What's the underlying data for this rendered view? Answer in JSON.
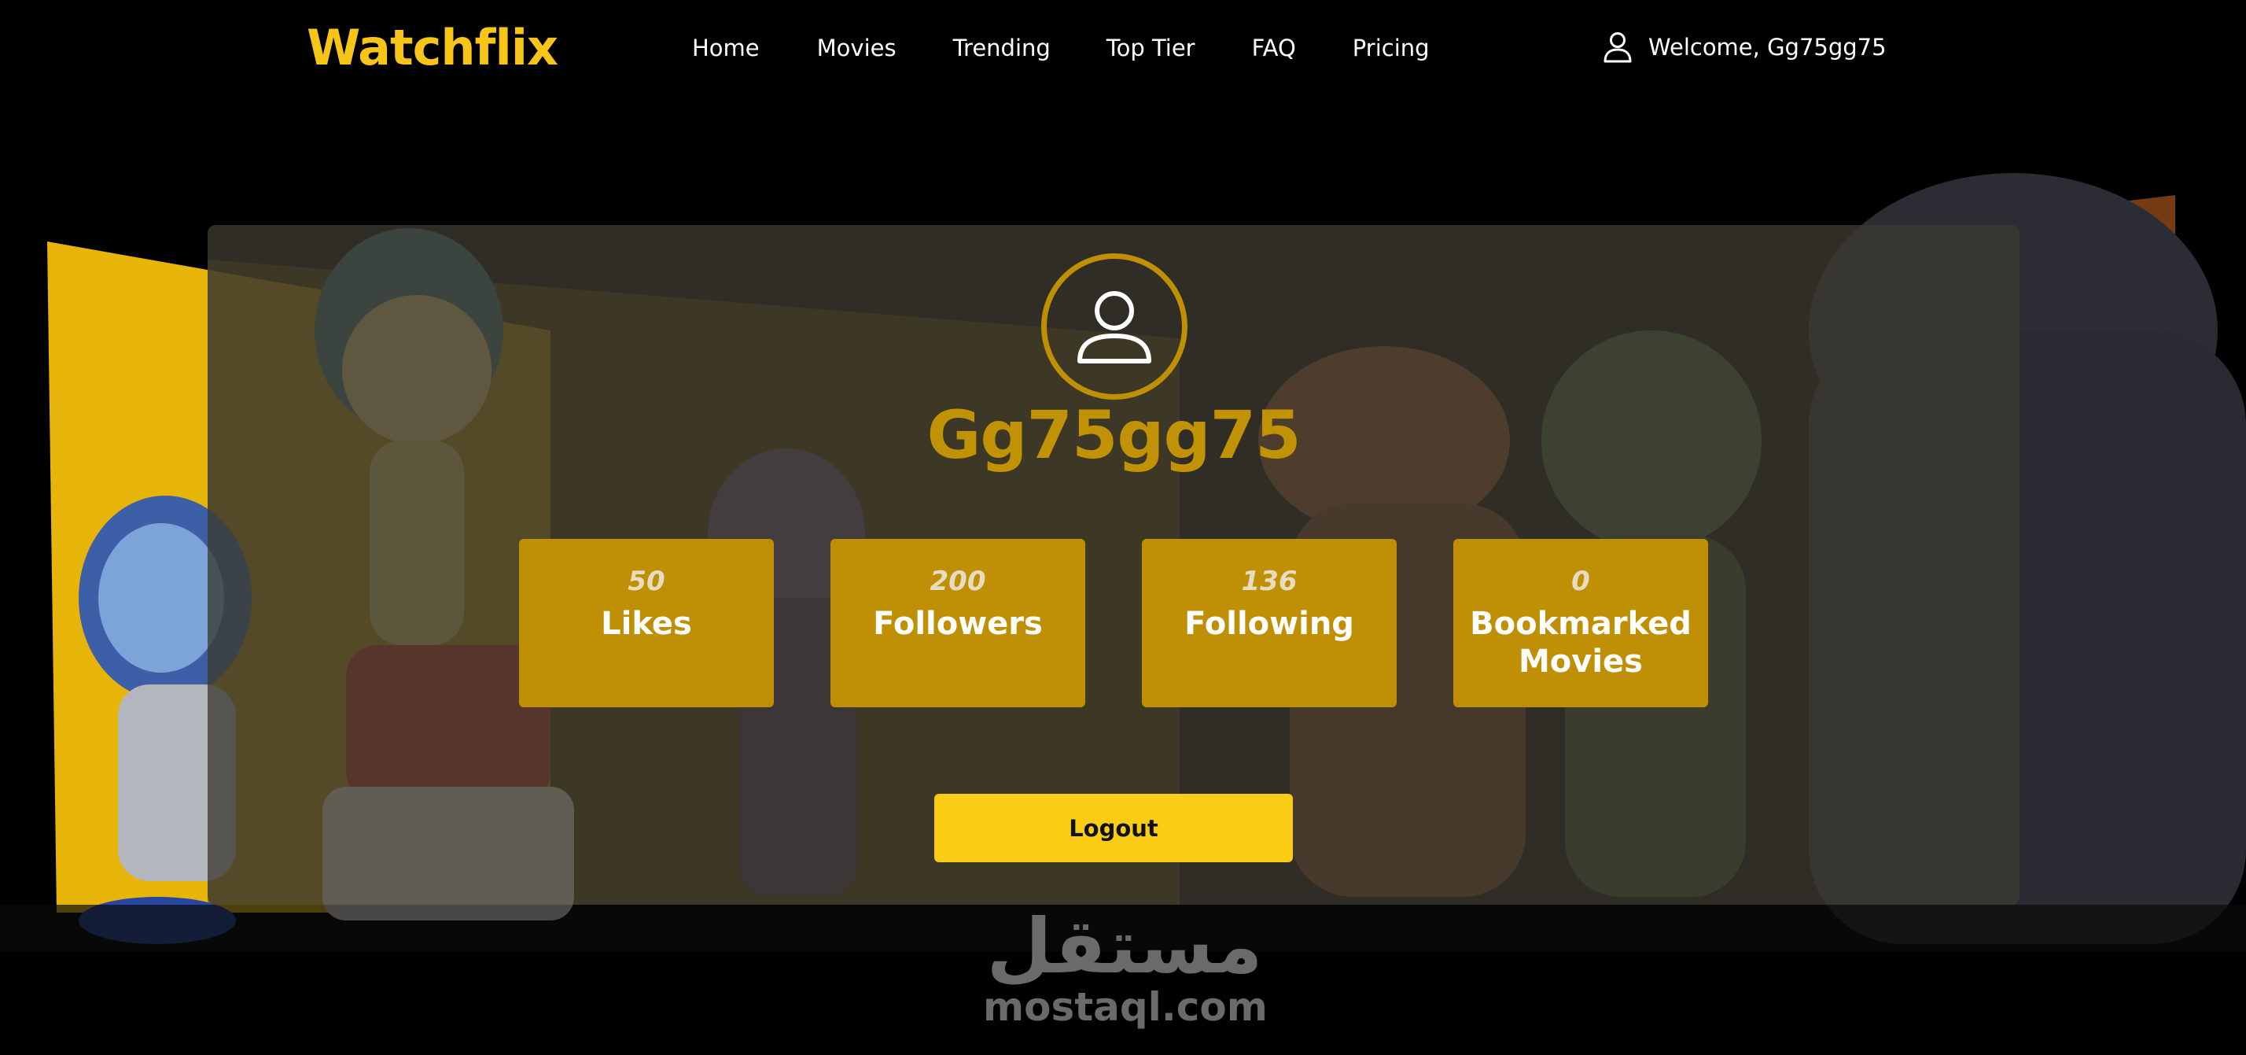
{
  "brand": {
    "name": "Watchflix",
    "accent_color": "#f7c518"
  },
  "nav": {
    "items": [
      {
        "label": "Home"
      },
      {
        "label": "Movies"
      },
      {
        "label": "Trending"
      },
      {
        "label": "Top Tier"
      },
      {
        "label": "FAQ"
      },
      {
        "label": "Pricing"
      }
    ],
    "welcome": "Welcome, Gg75gg75",
    "user_icon": "user-icon"
  },
  "profile": {
    "avatar_icon": "user-avatar-icon",
    "username": "Gg75gg75",
    "stats": [
      {
        "value": "50",
        "label": "Likes"
      },
      {
        "value": "200",
        "label": "Followers"
      },
      {
        "value": "136",
        "label": "Following"
      },
      {
        "value": "0",
        "label": "Bookmarked Movies"
      }
    ],
    "logout_label": "Logout"
  },
  "watermark": {
    "arabic": "مستقل",
    "latin": "mostaql.com"
  },
  "colors": {
    "background": "#000000",
    "card": "#3c3a30",
    "stat_box": "#bf9006",
    "username": "#c19205",
    "logout_button": "#facc15"
  }
}
